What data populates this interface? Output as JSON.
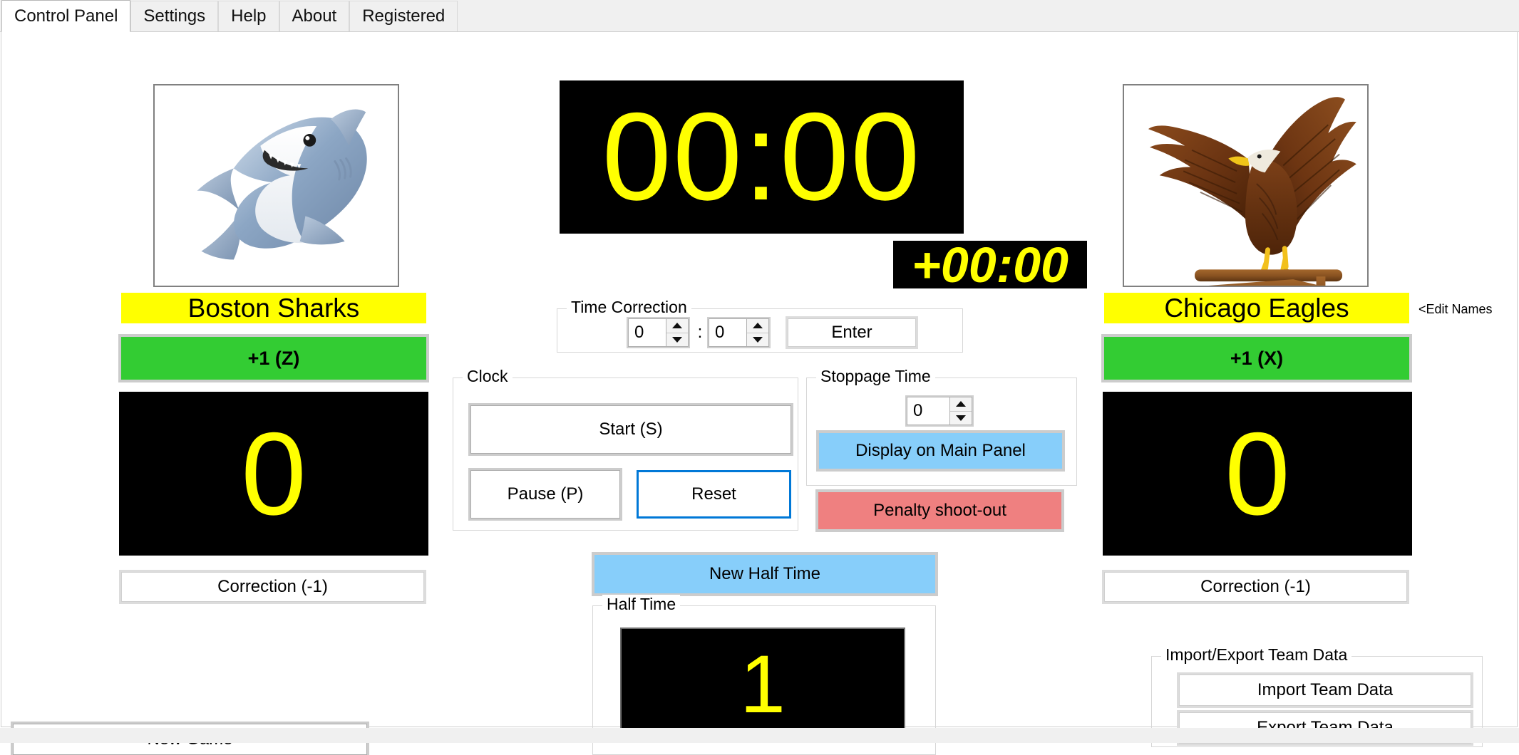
{
  "window": {
    "tabs": [
      {
        "label": "Control Panel",
        "active": true
      },
      {
        "label": "Settings",
        "active": false
      },
      {
        "label": "Help",
        "active": false
      },
      {
        "label": "About",
        "active": false
      },
      {
        "label": "Registered",
        "active": false
      }
    ]
  },
  "colors": {
    "accent_green": "#33cc33",
    "accent_blue": "#87cefa",
    "accent_red": "#ef8080",
    "banner_yellow": "#ffff00",
    "led_text": "#ffff00",
    "led_bg": "#000000",
    "focus_blue": "#0078d7"
  },
  "home_team": {
    "logo_name": "shark-logo",
    "name": "Boston Sharks",
    "add_point_label": "+1  (Z)",
    "score": "0",
    "correction_label": "Correction (-1)"
  },
  "away_team": {
    "logo_name": "eagle-logo",
    "name": "Chicago Eagles",
    "add_point_label": "+1  (X)",
    "score": "0",
    "correction_label": "Correction (-1)",
    "edit_names_label": "<Edit Names"
  },
  "clock_display": {
    "main_time": "00:00",
    "stoppage_time": "+00:00"
  },
  "time_correction": {
    "legend": "Time Correction",
    "minutes_value": "0",
    "separator": ":",
    "seconds_value": "0",
    "enter_label": "Enter"
  },
  "clock_controls": {
    "legend": "Clock",
    "start_label": "Start (S)",
    "pause_label": "Pause (P)",
    "reset_label": "Reset"
  },
  "stoppage": {
    "legend": "Stoppage Time",
    "minutes_value": "0",
    "display_label": "Display on Main Panel",
    "penalty_label": "Penalty shoot-out"
  },
  "half_time": {
    "new_half_label": "New Half Time",
    "legend": "Half Time",
    "value": "1"
  },
  "team_data": {
    "legend": "Import/Export Team Data",
    "import_label": "Import Team Data",
    "export_label": "Export Team Data"
  },
  "new_game": {
    "label": "New Game"
  }
}
